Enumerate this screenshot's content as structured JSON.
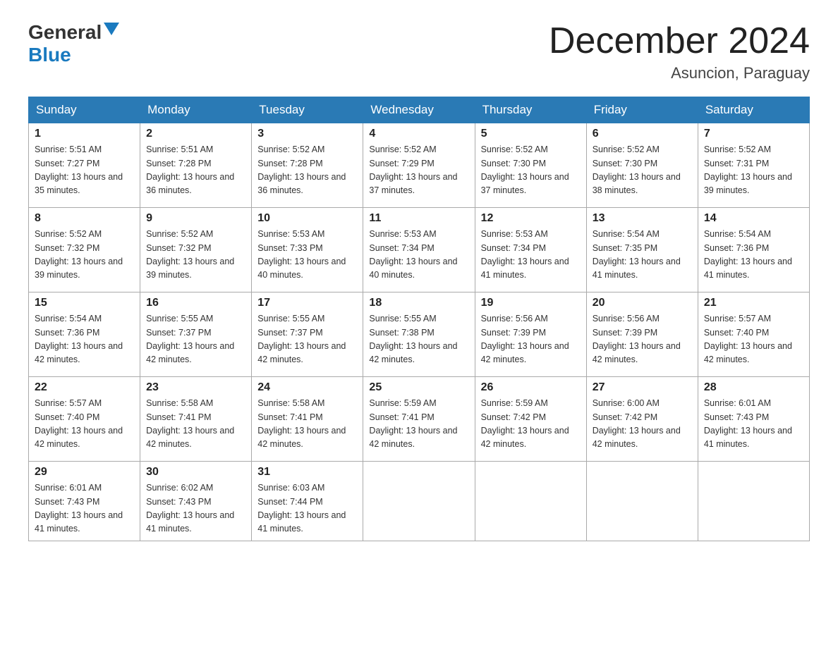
{
  "header": {
    "logo_general": "General",
    "logo_blue": "Blue",
    "month_title": "December 2024",
    "location": "Asuncion, Paraguay"
  },
  "days_of_week": [
    "Sunday",
    "Monday",
    "Tuesday",
    "Wednesday",
    "Thursday",
    "Friday",
    "Saturday"
  ],
  "weeks": [
    [
      {
        "day": "1",
        "sunrise": "5:51 AM",
        "sunset": "7:27 PM",
        "daylight": "13 hours and 35 minutes."
      },
      {
        "day": "2",
        "sunrise": "5:51 AM",
        "sunset": "7:28 PM",
        "daylight": "13 hours and 36 minutes."
      },
      {
        "day": "3",
        "sunrise": "5:52 AM",
        "sunset": "7:28 PM",
        "daylight": "13 hours and 36 minutes."
      },
      {
        "day": "4",
        "sunrise": "5:52 AM",
        "sunset": "7:29 PM",
        "daylight": "13 hours and 37 minutes."
      },
      {
        "day": "5",
        "sunrise": "5:52 AM",
        "sunset": "7:30 PM",
        "daylight": "13 hours and 37 minutes."
      },
      {
        "day": "6",
        "sunrise": "5:52 AM",
        "sunset": "7:30 PM",
        "daylight": "13 hours and 38 minutes."
      },
      {
        "day": "7",
        "sunrise": "5:52 AM",
        "sunset": "7:31 PM",
        "daylight": "13 hours and 39 minutes."
      }
    ],
    [
      {
        "day": "8",
        "sunrise": "5:52 AM",
        "sunset": "7:32 PM",
        "daylight": "13 hours and 39 minutes."
      },
      {
        "day": "9",
        "sunrise": "5:52 AM",
        "sunset": "7:32 PM",
        "daylight": "13 hours and 39 minutes."
      },
      {
        "day": "10",
        "sunrise": "5:53 AM",
        "sunset": "7:33 PM",
        "daylight": "13 hours and 40 minutes."
      },
      {
        "day": "11",
        "sunrise": "5:53 AM",
        "sunset": "7:34 PM",
        "daylight": "13 hours and 40 minutes."
      },
      {
        "day": "12",
        "sunrise": "5:53 AM",
        "sunset": "7:34 PM",
        "daylight": "13 hours and 41 minutes."
      },
      {
        "day": "13",
        "sunrise": "5:54 AM",
        "sunset": "7:35 PM",
        "daylight": "13 hours and 41 minutes."
      },
      {
        "day": "14",
        "sunrise": "5:54 AM",
        "sunset": "7:36 PM",
        "daylight": "13 hours and 41 minutes."
      }
    ],
    [
      {
        "day": "15",
        "sunrise": "5:54 AM",
        "sunset": "7:36 PM",
        "daylight": "13 hours and 42 minutes."
      },
      {
        "day": "16",
        "sunrise": "5:55 AM",
        "sunset": "7:37 PM",
        "daylight": "13 hours and 42 minutes."
      },
      {
        "day": "17",
        "sunrise": "5:55 AM",
        "sunset": "7:37 PM",
        "daylight": "13 hours and 42 minutes."
      },
      {
        "day": "18",
        "sunrise": "5:55 AM",
        "sunset": "7:38 PM",
        "daylight": "13 hours and 42 minutes."
      },
      {
        "day": "19",
        "sunrise": "5:56 AM",
        "sunset": "7:39 PM",
        "daylight": "13 hours and 42 minutes."
      },
      {
        "day": "20",
        "sunrise": "5:56 AM",
        "sunset": "7:39 PM",
        "daylight": "13 hours and 42 minutes."
      },
      {
        "day": "21",
        "sunrise": "5:57 AM",
        "sunset": "7:40 PM",
        "daylight": "13 hours and 42 minutes."
      }
    ],
    [
      {
        "day": "22",
        "sunrise": "5:57 AM",
        "sunset": "7:40 PM",
        "daylight": "13 hours and 42 minutes."
      },
      {
        "day": "23",
        "sunrise": "5:58 AM",
        "sunset": "7:41 PM",
        "daylight": "13 hours and 42 minutes."
      },
      {
        "day": "24",
        "sunrise": "5:58 AM",
        "sunset": "7:41 PM",
        "daylight": "13 hours and 42 minutes."
      },
      {
        "day": "25",
        "sunrise": "5:59 AM",
        "sunset": "7:41 PM",
        "daylight": "13 hours and 42 minutes."
      },
      {
        "day": "26",
        "sunrise": "5:59 AM",
        "sunset": "7:42 PM",
        "daylight": "13 hours and 42 minutes."
      },
      {
        "day": "27",
        "sunrise": "6:00 AM",
        "sunset": "7:42 PM",
        "daylight": "13 hours and 42 minutes."
      },
      {
        "day": "28",
        "sunrise": "6:01 AM",
        "sunset": "7:43 PM",
        "daylight": "13 hours and 41 minutes."
      }
    ],
    [
      {
        "day": "29",
        "sunrise": "6:01 AM",
        "sunset": "7:43 PM",
        "daylight": "13 hours and 41 minutes."
      },
      {
        "day": "30",
        "sunrise": "6:02 AM",
        "sunset": "7:43 PM",
        "daylight": "13 hours and 41 minutes."
      },
      {
        "day": "31",
        "sunrise": "6:03 AM",
        "sunset": "7:44 PM",
        "daylight": "13 hours and 41 minutes."
      },
      null,
      null,
      null,
      null
    ]
  ]
}
